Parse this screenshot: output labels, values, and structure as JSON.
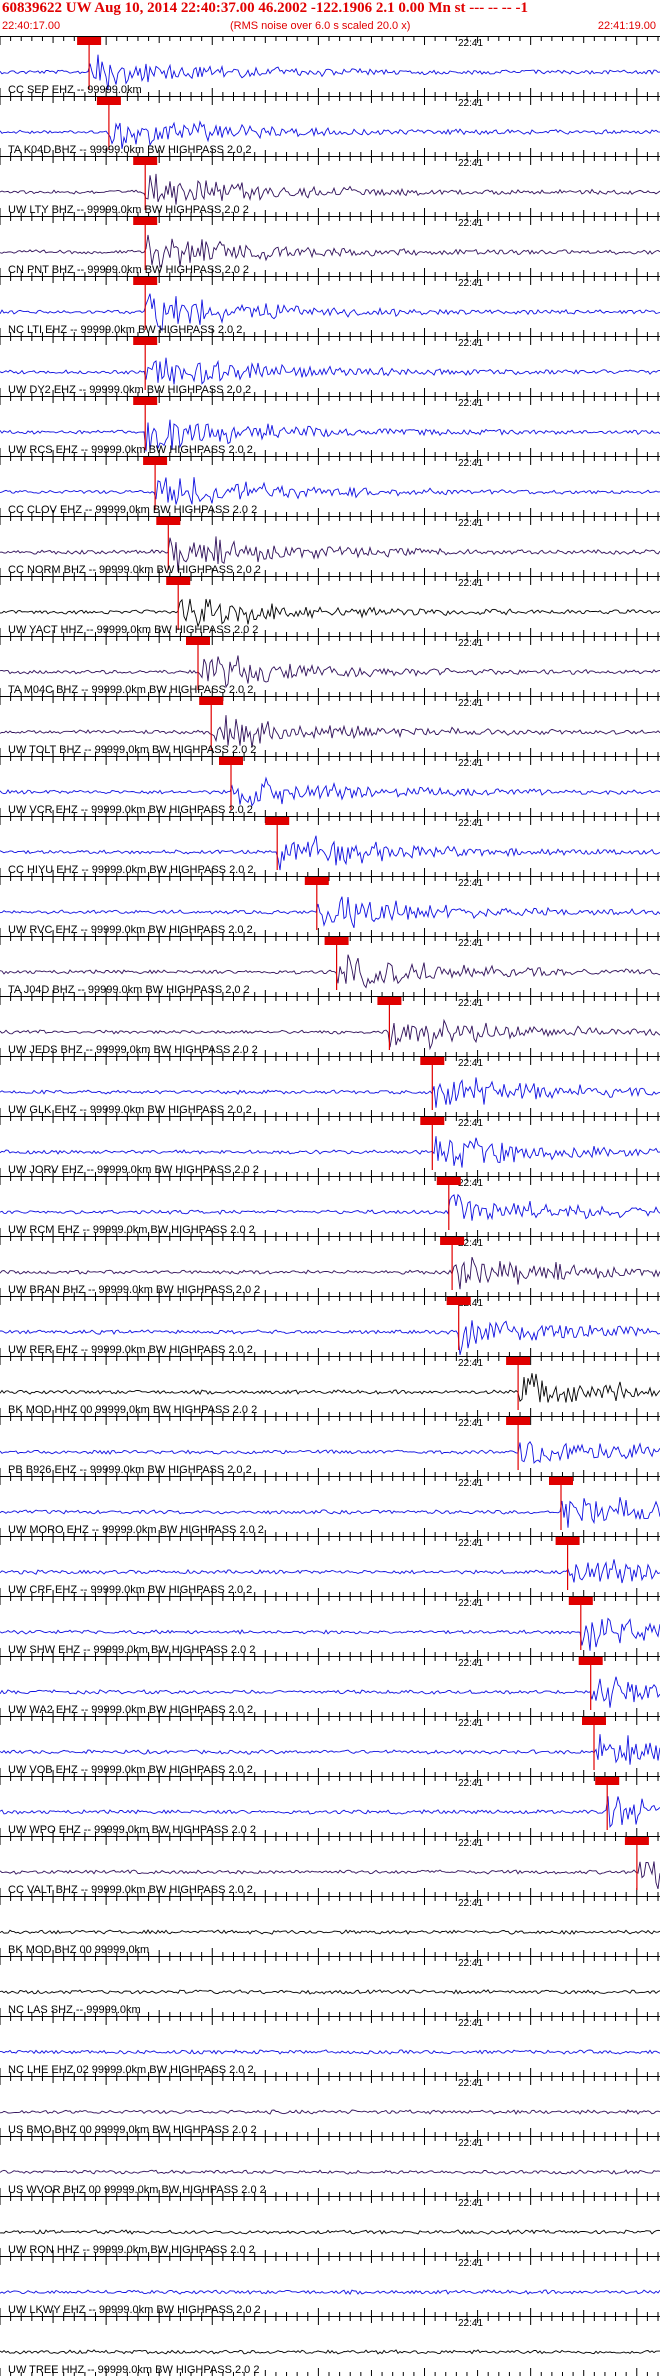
{
  "header": {
    "title": "60839622 UW Aug 10, 2014 22:40:37.00   46.2002 -122.1906  2.1 0.00 Mn st --- -- --   -1",
    "start_time": "22:40:17.00",
    "scale_note": "(RMS noise over 6.0 s scaled 20.0 x)",
    "end_time": "22:41:19.00"
  },
  "tick_time_label": "22:41",
  "colors": {
    "title": "#e00000",
    "pick_marker": "#e00000",
    "trace_blue": "#1010e0",
    "trace_black": "#000000",
    "trace_purple": "#30105a"
  },
  "traces": [
    {
      "label": "CC SEP EHZ -- 99999.0km",
      "color": "blue",
      "pick": 0.135
    },
    {
      "label": "TA K04D BHZ -- 99999.0km BW  HIGHPASS  2.0  2",
      "color": "blue",
      "pick": 0.165
    },
    {
      "label": "UW LTY BHZ -- 99999.0km BW  HIGHPASS  2.0  2",
      "color": "purple",
      "pick": 0.22
    },
    {
      "label": "CN PNT BHZ -- 99999.0km BW  HIGHPASS  2.0  2",
      "color": "purple",
      "pick": 0.22
    },
    {
      "label": "NC LTI EHZ -- 99999.0km BW  HIGHPASS  2.0  2",
      "color": "blue",
      "pick": 0.22
    },
    {
      "label": "UW DY2 EHZ -- 99999.0km BW  HIGHPASS  2.0  2",
      "color": "blue",
      "pick": 0.22
    },
    {
      "label": "UW RCS EHZ -- 99999.0km BW  HIGHPASS  2.0  2",
      "color": "blue",
      "pick": 0.22
    },
    {
      "label": "CC CLOV EHZ -- 99999.0km BW  HIGHPASS  2.0  2",
      "color": "blue",
      "pick": 0.235
    },
    {
      "label": "CC NORM BHZ -- 99999.0km BW  HIGHPASS  2.0  2",
      "color": "purple",
      "pick": 0.255
    },
    {
      "label": "UW YACT HHZ -- 99999.0km BW  HIGHPASS  2.0  2",
      "color": "black",
      "pick": 0.27
    },
    {
      "label": "TA M04C BHZ -- 99999.0km BW  HIGHPASS  2.0  2",
      "color": "purple",
      "pick": 0.3
    },
    {
      "label": "UW TOLT BHZ -- 99999.0km BW  HIGHPASS  2.0  2",
      "color": "purple",
      "pick": 0.32
    },
    {
      "label": "UW VCR EHZ -- 99999.0km BW  HIGHPASS  2.0  2",
      "color": "blue",
      "pick": 0.35
    },
    {
      "label": "CC HIYU EHZ -- 99999.0km BW  HIGHPASS  2.0  2",
      "color": "blue",
      "pick": 0.42
    },
    {
      "label": "UW RVC EHZ -- 99999.0km BW  HIGHPASS  2.0  2",
      "color": "blue",
      "pick": 0.48
    },
    {
      "label": "TA J04D BHZ -- 99999.0km BW  HIGHPASS  2.0  2",
      "color": "purple",
      "pick": 0.51
    },
    {
      "label": "UW JEDS BHZ -- 99999.0km BW  HIGHPASS  2.0  2",
      "color": "purple",
      "pick": 0.59
    },
    {
      "label": "UW GLK EHZ -- 99999.0km BW  HIGHPASS  2.0  2",
      "color": "blue",
      "pick": 0.655
    },
    {
      "label": "UW JORV EHZ -- 99999.0km BW  HIGHPASS  2.0  2",
      "color": "blue",
      "pick": 0.655
    },
    {
      "label": "UW RCM EHZ -- 99999.0km BW  HIGHPASS  2.0  2",
      "color": "blue",
      "pick": 0.68
    },
    {
      "label": "UW BRAN BHZ -- 99999.0km BW  HIGHPASS  2.0  2",
      "color": "purple",
      "pick": 0.685
    },
    {
      "label": "UW RER EHZ -- 99999.0km BW  HIGHPASS  2.0  2",
      "color": "blue",
      "pick": 0.695
    },
    {
      "label": "BK MOD HHZ 00 99999.0km BW  HIGHPASS  2.0  2",
      "color": "black",
      "pick": 0.785
    },
    {
      "label": "PB B926 EHZ -- 99999.0km BW  HIGHPASS  2.0  2",
      "color": "blue",
      "pick": 0.785
    },
    {
      "label": "UW MORO EHZ -- 99999.0km BW  HIGHPASS  2.0  2",
      "color": "blue",
      "pick": 0.85
    },
    {
      "label": "UW CRF EHZ -- 99999.0km BW  HIGHPASS  2.0  2",
      "color": "blue",
      "pick": 0.86
    },
    {
      "label": "UW SHW EHZ -- 99999.0km BW  HIGHPASS  2.0  2",
      "color": "blue",
      "pick": 0.88
    },
    {
      "label": "UW WA2 EHZ -- 99999.0km BW  HIGHPASS  2.0  2",
      "color": "blue",
      "pick": 0.895
    },
    {
      "label": "UW VOB EHZ -- 99999.0km BW  HIGHPASS  2.0  2",
      "color": "blue",
      "pick": 0.9
    },
    {
      "label": "UW WPO EHZ -- 99999.0km BW  HIGHPASS  2.0  2",
      "color": "blue",
      "pick": 0.92
    },
    {
      "label": "CC VALT BHZ -- 99999.0km BW  HIGHPASS  2.0  2",
      "color": "purple",
      "pick": 0.965
    },
    {
      "label": "BK MOD BHZ 00 99999.0km",
      "color": "black",
      "pick": null
    },
    {
      "label": "NC LAS SHZ -- 99999.0km",
      "color": "black",
      "pick": null
    },
    {
      "label": "NC LHE EHZ 02 99999.0km BW  HIGHPASS  2.0  2",
      "color": "blue",
      "pick": null
    },
    {
      "label": "US BMO BHZ 00 99999.0km BW  HIGHPASS  2.0  2",
      "color": "purple",
      "pick": null
    },
    {
      "label": "US WVOR BHZ 00 99999.0km BW  HIGHPASS  2.0  2",
      "color": "purple",
      "pick": null
    },
    {
      "label": "UW RON HHZ -- 99999.0km BW  HIGHPASS  2.0  2",
      "color": "black",
      "pick": null
    },
    {
      "label": "UW LKWY EHZ -- 99999.0km BW  HIGHPASS  2.0  2",
      "color": "blue",
      "pick": null
    },
    {
      "label": "UW TREE HHZ -- 99999.0km BW  HIGHPASS  2.0  2",
      "color": "black",
      "pick": null
    }
  ]
}
